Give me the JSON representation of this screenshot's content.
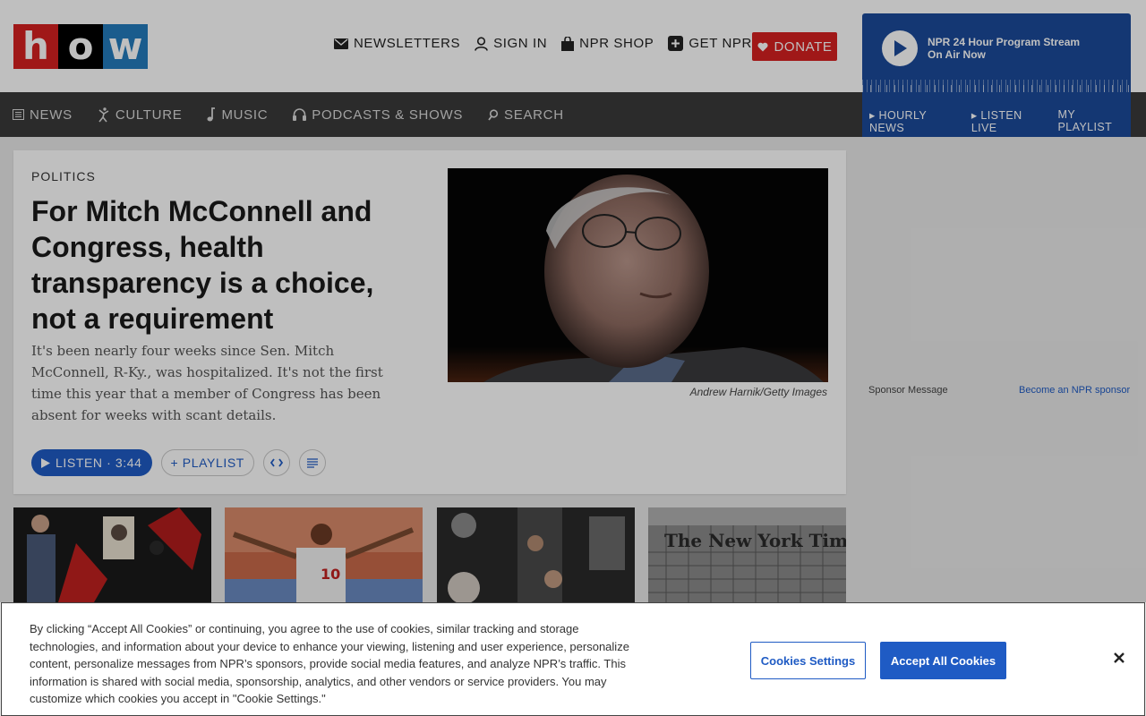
{
  "logo": {
    "letters": [
      "h",
      "o",
      "w"
    ]
  },
  "util_nav": [
    {
      "label": "NEWSLETTERS",
      "icon": "envelope-icon"
    },
    {
      "label": "SIGN IN",
      "icon": "user-icon"
    },
    {
      "label": "NPR SHOP",
      "icon": "shopping-bag-icon"
    },
    {
      "label": "GET NPR+",
      "icon": "plus-icon"
    }
  ],
  "donate": {
    "label": "DONATE",
    "icon": "heart-icon",
    "color": "#d62021"
  },
  "player": {
    "title": "NPR 24 Hour Program Stream",
    "subtitle": "On Air Now",
    "links": [
      "▸ HOURLY NEWS",
      "▸ LISTEN LIVE",
      "MY PLAYLIST"
    ],
    "color": "#1b4a9a"
  },
  "main_nav": [
    {
      "label": "NEWS",
      "icon": "newspaper-icon"
    },
    {
      "label": "CULTURE",
      "icon": "dancer-icon"
    },
    {
      "label": "MUSIC",
      "icon": "music-note-icon"
    },
    {
      "label": "PODCASTS & SHOWS",
      "icon": "headphones-icon"
    },
    {
      "label": "SEARCH",
      "icon": "search-icon"
    }
  ],
  "story": {
    "slug": "POLITICS",
    "headline": "For Mitch McConnell and Congress, health transparency is a choice, not a requirement",
    "teaser": "It's been nearly four weeks since Sen. Mitch McConnell, R-Ky., was hospitalized. It's not the first time this year that a member of Congress has been absent for weeks with scant details.",
    "credit": "Andrew Harnik/Getty Images",
    "listen_label": "LISTEN · 3:44",
    "playlist_label": "+ PLAYLIST"
  },
  "sponsor": {
    "label": "Sponsor Message",
    "link": "Become an NPR sponsor"
  },
  "thumbnails": [
    {
      "alt": "protest-photo"
    },
    {
      "alt": "soccer-player-photo"
    },
    {
      "alt": "subway-photo"
    },
    {
      "alt": "new-york-times-building-photo",
      "sign": "The New York Times"
    }
  ],
  "cookie": {
    "text": "By clicking “Accept All Cookies” or continuing, you agree to the use of cookies, similar tracking and storage technologies, and information about your device to enhance your viewing, listening and user experience, personalize content, personalize messages from NPR’s sponsors, provide social media features, and analyze NPR’s traffic. This information is shared with social media, sponsorship, analytics, and other vendors or service providers. You may customize which cookies you accept in \"Cookie Settings.\"",
    "settings_label": "Cookies Settings",
    "accept_label": "Accept All Cookies",
    "accent": "#1f5bc4"
  }
}
